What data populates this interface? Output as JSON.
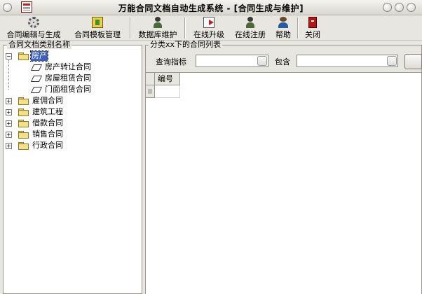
{
  "window": {
    "title": "万能合同文档自动生成系统 - [合同生成与维护]"
  },
  "toolbar": {
    "contract_edit": "合同编辑与生成",
    "template_manage": "合同模板管理",
    "db_maintain": "数据库维护",
    "online_upgrade": "在线升级",
    "online_register": "在线注册",
    "help": "帮助",
    "close": "关闭"
  },
  "left_pane": {
    "title": "合同文档类别名称",
    "tree": [
      {
        "label": "房产",
        "expander": "−",
        "selected": true
      },
      {
        "label": "房产转让合同"
      },
      {
        "label": "房屋租赁合同"
      },
      {
        "label": "门面租赁合同"
      },
      {
        "label": "雇佣合同",
        "expander": "+"
      },
      {
        "label": "建筑工程",
        "expander": "+"
      },
      {
        "label": "借款合同",
        "expander": "+"
      },
      {
        "label": "销售合同",
        "expander": "+"
      },
      {
        "label": "行政合同",
        "expander": "+"
      }
    ]
  },
  "right_pane": {
    "title": "分类xx下的合同列表",
    "query_label": "查询指标",
    "contains_label": "包含",
    "query_value": "",
    "contains_value": "",
    "grid_columns": [
      "编号"
    ]
  },
  "icons": [
    "gear-icon",
    "template-icon",
    "database-icon",
    "upgrade-icon",
    "register-icon",
    "help-icon",
    "close-icon",
    "folder-icon",
    "document-icon"
  ]
}
